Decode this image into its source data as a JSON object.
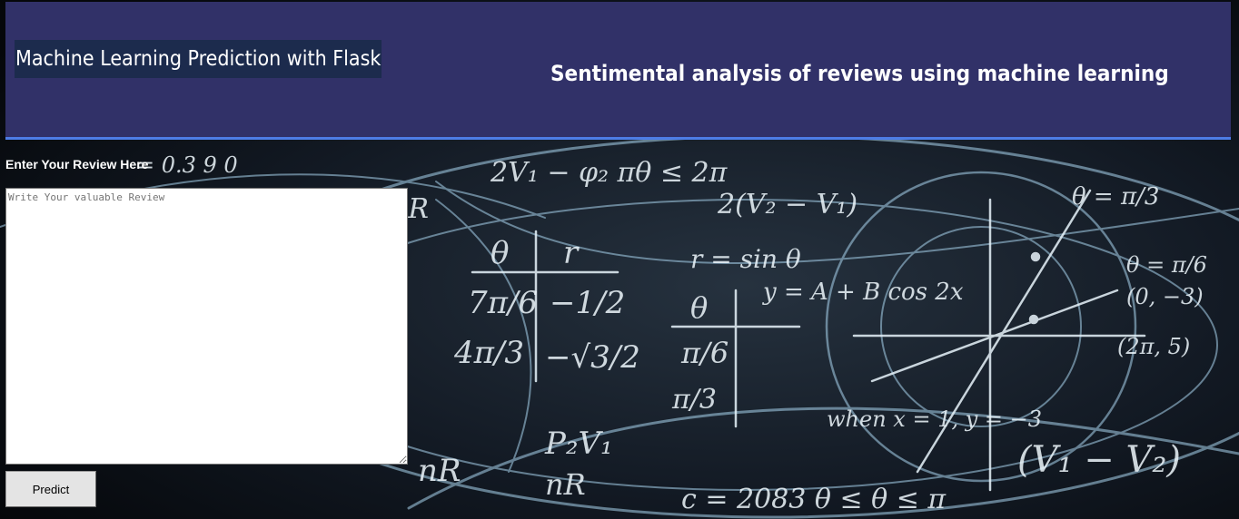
{
  "header": {
    "title": "Machine Learning Prediction with Flask",
    "subtitle": "Sentimental analysis of reviews using machine learning"
  },
  "form": {
    "review_label": "Enter Your Review Here",
    "review_placeholder": "Write Your valuable Review",
    "review_value": "",
    "predict_label": "Predict"
  },
  "colors": {
    "header_bg": "#313168",
    "header_border": "#4d7de6",
    "title_bg": "#1c2b4d",
    "background": "#0a0d12",
    "text": "#ffffff"
  },
  "icons": {
    "background_image": "math-chalkboard-background"
  }
}
